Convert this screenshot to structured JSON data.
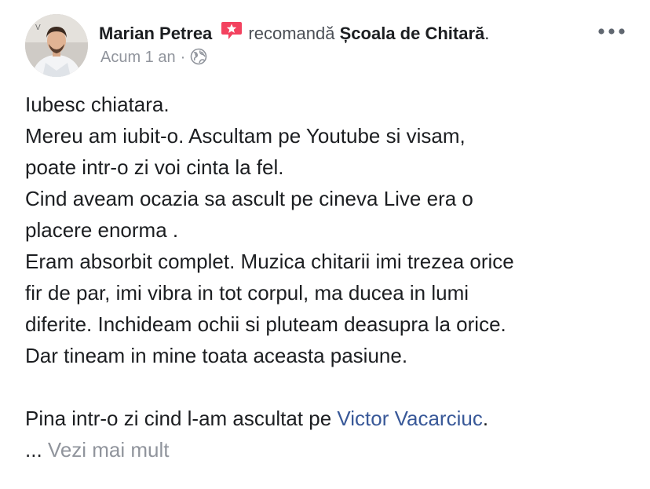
{
  "post": {
    "author": "Marian Petrea",
    "badge_icon": "recommendation-badge-icon",
    "action_text": "recomandă",
    "page_name": "Școala de Chitară",
    "punctuation": ".",
    "timestamp": "Acum 1 an",
    "meta_separator": "·",
    "privacy_icon": "globe-icon",
    "more_icon": "more-options-icon",
    "lines": [
      "Iubesc chiatara.",
      "Mereu am iubit-o. Ascultam pe Youtube si visam,",
      "poate intr-o zi voi cinta la fel.",
      "Cind aveam ocazia sa ascult pe cineva Live era o",
      "placere enorma .",
      "Eram absorbit complet. Muzica chitarii imi trezea orice",
      "fir de par, imi vibra in tot corpul, ma ducea in lumi",
      "diferite. Inchideam ochii si pluteam deasupra la orice.",
      "Dar tineam in mine toata aceasta pasiune."
    ],
    "final_line_prefix": "Pina intr-o zi cind l-am ascultat pe ",
    "mention": "Victor Vacarciuc",
    "final_line_suffix": ".",
    "ellipsis": "...",
    "see_more": "Vezi mai mult"
  },
  "colors": {
    "text": "#1c1e21",
    "secondary": "#90949c",
    "link": "#385898",
    "badge": "#f3425f"
  }
}
